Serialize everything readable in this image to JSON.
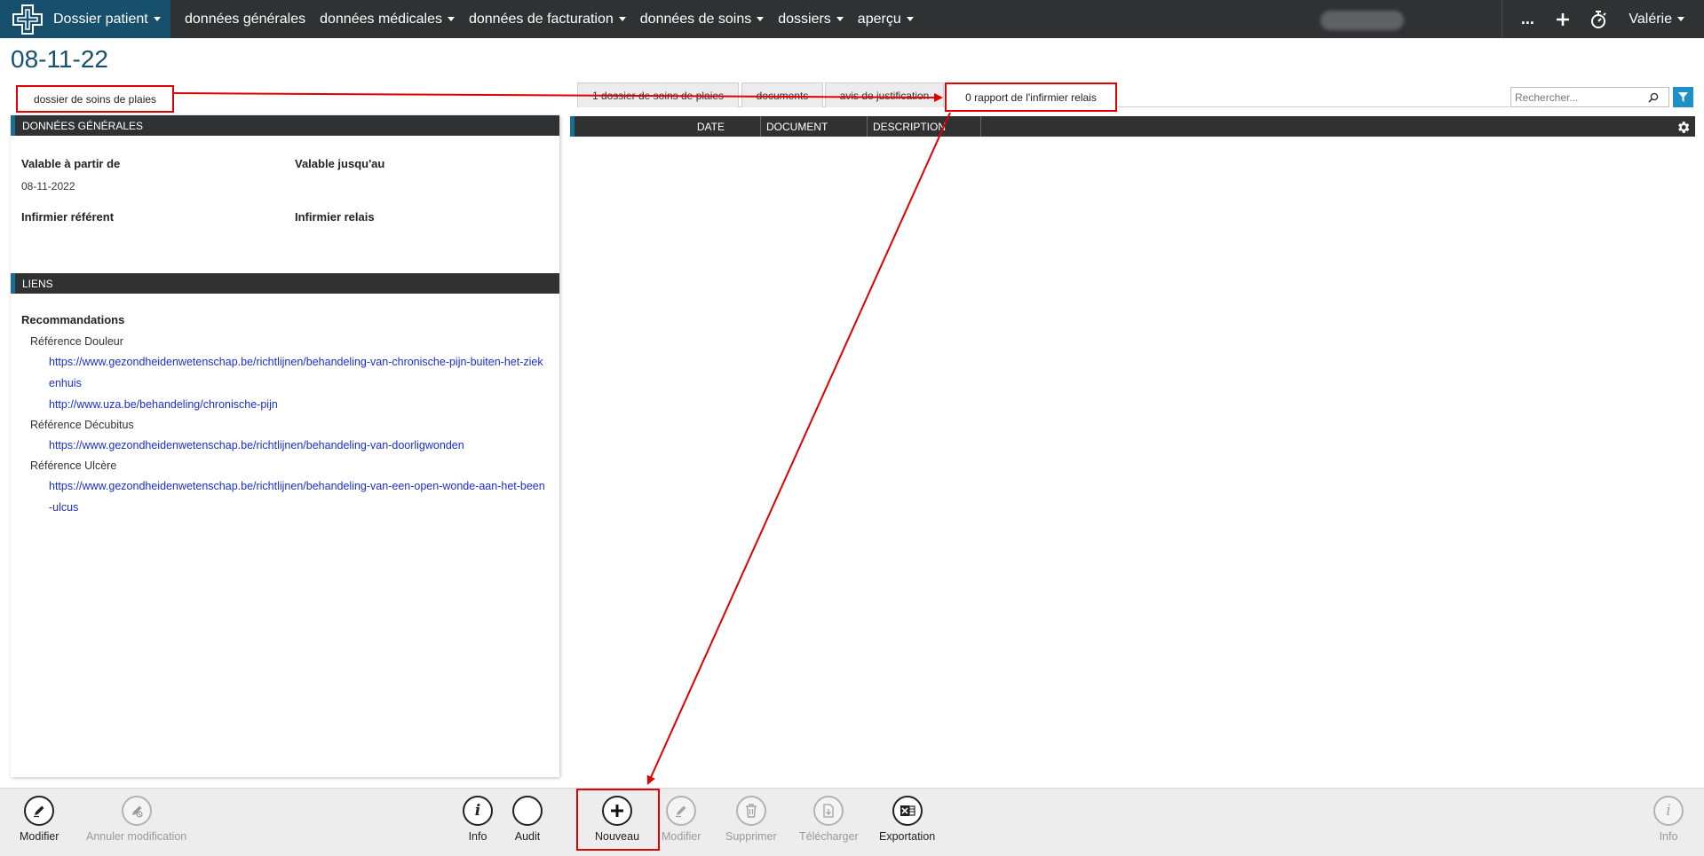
{
  "navbar": {
    "brand_label": "Dossier patient",
    "items": [
      {
        "label": "données générales",
        "has_caret": false
      },
      {
        "label": "données médicales",
        "has_caret": true
      },
      {
        "label": "données de facturation",
        "has_caret": true
      },
      {
        "label": "données de soins",
        "has_caret": true
      },
      {
        "label": "dossiers",
        "has_caret": true
      },
      {
        "label": "aperçu",
        "has_caret": true
      }
    ],
    "more_label": "...",
    "user_label": "Valérie"
  },
  "page": {
    "title": "08-11-22"
  },
  "tabs": {
    "left_label": "dossier de soins de plaies",
    "items": [
      {
        "label": "1 dossier de soins de plaies"
      },
      {
        "label": "documents"
      },
      {
        "label": "avis de justification"
      }
    ],
    "active_label": "0 rapport de l'infirmier relais"
  },
  "search": {
    "placeholder": "Rechercher..."
  },
  "general": {
    "header": "DONNÉES GÉNÉRALES",
    "valid_from_label": "Valable à partir de",
    "valid_from_value": "08-11-2022",
    "valid_until_label": "Valable jusqu'au",
    "ref_nurse_label": "Infirmier référent",
    "relay_nurse_label": "Infirmier relais"
  },
  "links": {
    "header": "LIENS",
    "title": "Recommandations",
    "groups": [
      {
        "label": "Référence Douleur",
        "urls": [
          "https://www.gezondheidenwetenschap.be/richtlijnen/behandeling-van-chronische-pijn-buiten-het-ziekenhuis",
          "http://www.uza.be/behandeling/chronische-pijn"
        ]
      },
      {
        "label": "Référence Décubitus",
        "urls": [
          "https://www.gezondheidenwetenschap.be/richtlijnen/behandeling-van-doorligwonden"
        ]
      },
      {
        "label": "Référence Ulcère",
        "urls": [
          "https://www.gezondheidenwetenschap.be/richtlijnen/behandeling-van-een-open-wonde-aan-het-been-ulcus"
        ]
      }
    ]
  },
  "table": {
    "columns": [
      "DATE",
      "DOCUMENT",
      "DESCRIPTION"
    ]
  },
  "toolbar": {
    "modifier": "Modifier",
    "annuler": "Annuler modification",
    "info": "Info",
    "audit": "Audit",
    "nouveau": "Nouveau",
    "modifier2": "Modifier",
    "supprimer": "Supprimer",
    "telecharger": "Télécharger",
    "exportation": "Exportation",
    "info_right": "Info"
  },
  "colors": {
    "navbar": "#2f3133",
    "brand": "#16506d",
    "accent": "#1a6d95",
    "annotation_red": "#e00000",
    "link": "#1a2fd0"
  }
}
